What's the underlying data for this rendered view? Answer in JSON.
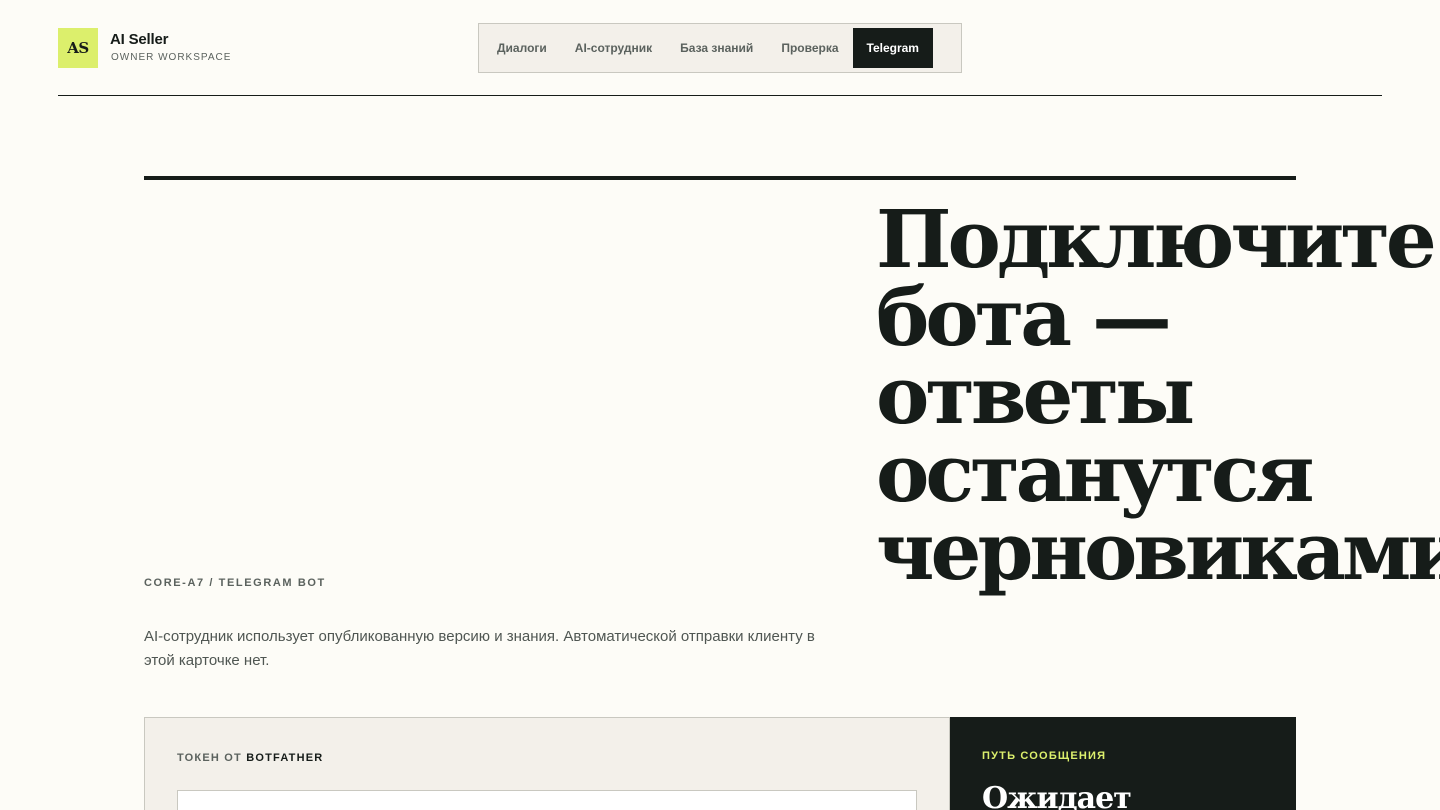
{
  "brand": {
    "mark": "AS",
    "name": "AI Seller",
    "subtitle": "OWNER WORKSPACE"
  },
  "nav": {
    "items": [
      {
        "label": "Диалоги",
        "active": false
      },
      {
        "label": "AI-сотрудник",
        "active": false
      },
      {
        "label": "База знаний",
        "active": false
      },
      {
        "label": "Проверка",
        "active": false
      },
      {
        "label": "Telegram",
        "active": true
      }
    ]
  },
  "hero": {
    "headline_lines": [
      "Подключите",
      "бота —",
      "ответы",
      "останутся",
      "черновиками."
    ],
    "eyebrow": "CORE-A7 / TELEGRAM BOT",
    "description": "AI-сотрудник использует опубликованную версию и знания. Автоматической отправки клиенту в этой карточке нет."
  },
  "token_form": {
    "label_prefix": "ТОКЕН ОТ ",
    "label_strong": "BOTFATHER",
    "value": ""
  },
  "route": {
    "label": "ПУТЬ СООБЩЕНИЯ",
    "status": "Ожидает"
  },
  "colors": {
    "background": "#fdfcf7",
    "ink": "#161c19",
    "accent": "#dcef6c",
    "panel": "#f3f0ea"
  }
}
